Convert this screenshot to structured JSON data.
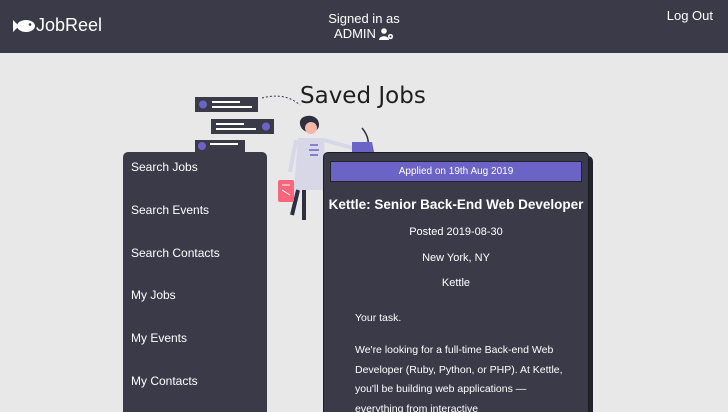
{
  "header": {
    "logo_text": "JobReel",
    "logo_icon": "fish-icon",
    "signed_in_label": "Signed in as",
    "user_name": "ADMIN",
    "user_icon": "user-gear-icon",
    "logout_label": "Log Out"
  },
  "page": {
    "title": "Saved Jobs"
  },
  "sidebar": {
    "items": [
      {
        "label": "Search Jobs"
      },
      {
        "label": "Search Events"
      },
      {
        "label": "Search Contacts"
      },
      {
        "label": "My Jobs"
      },
      {
        "label": "My Events"
      },
      {
        "label": "My Contacts"
      }
    ]
  },
  "job_card": {
    "applied_banner": "Applied on 19th Aug 2019",
    "title": "Kettle: Senior Back-End Web Developer",
    "posted": "Posted 2019-08-30",
    "location": "New York, NY",
    "company": "Kettle",
    "task_heading": "Your task.",
    "description": "We're looking for a full-time Back-end Web Developer (Ruby, Python, or PHP). At Kettle, you'll be building web applications —everything from interactive"
  },
  "colors": {
    "header_bg": "#3b3a49",
    "page_bg": "#e8e8e8",
    "accent": "#6c63c7"
  }
}
